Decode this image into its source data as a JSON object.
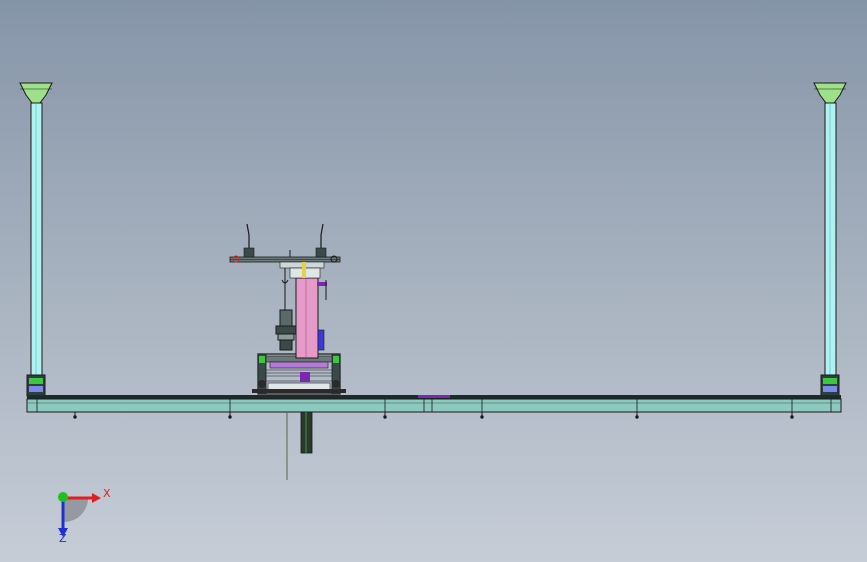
{
  "triad": {
    "x_label": "X",
    "z_label": "Z",
    "x_color": "#e02020",
    "z_color": "#2030d0",
    "y_color": "#20c020"
  },
  "colors": {
    "column": "#aef2f2",
    "cap": "#9fe08a",
    "beam": "#8cc9bf",
    "beam_dark": "#1c2c2c",
    "outline": "#1a1a1a",
    "pink_column": "#e69ac8",
    "purple": "#7a28b0",
    "green_parts": "#3cc83c",
    "shaft": "#2a3a2a"
  }
}
